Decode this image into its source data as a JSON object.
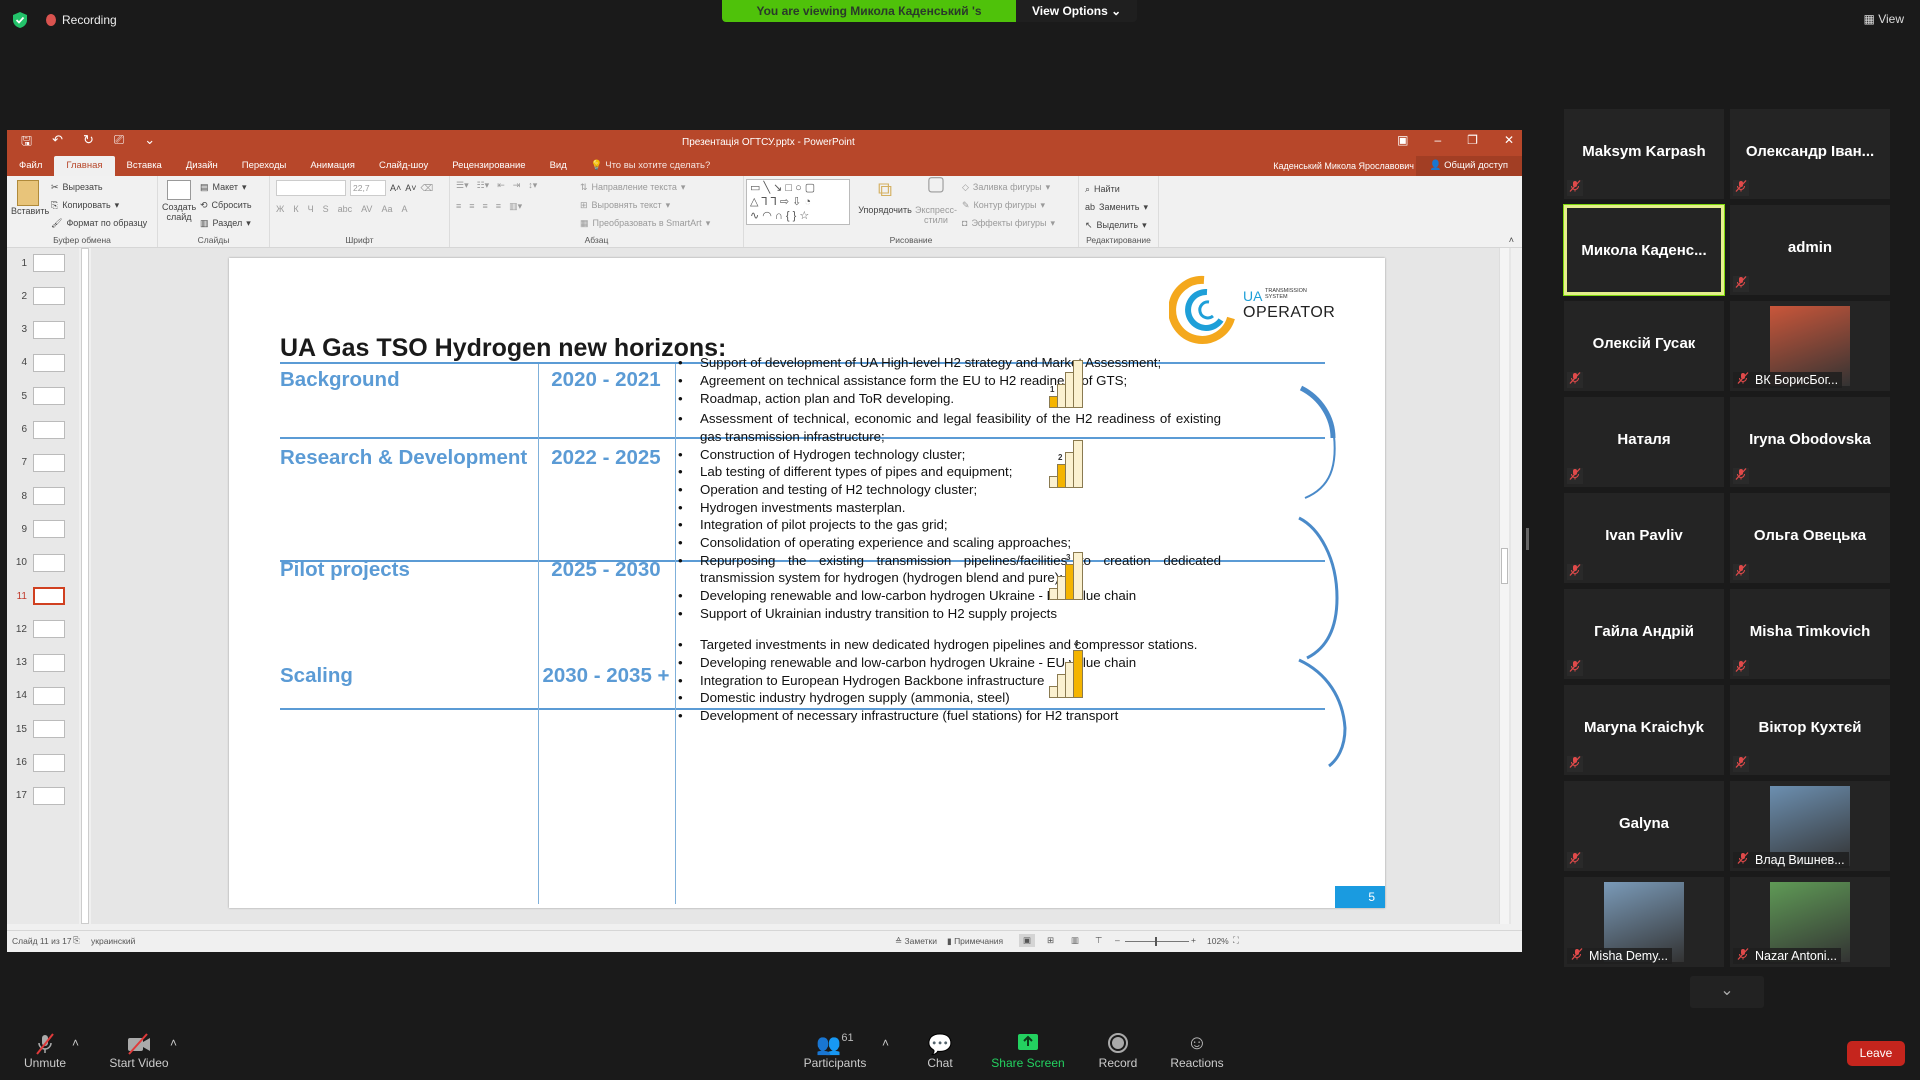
{
  "zoom": {
    "recording_label": "Recording",
    "viewing_banner": "You are viewing Микола Каденський 's screen",
    "view_options_label": "View Options",
    "top_view_label": "View",
    "toolbar": {
      "unmute": "Unmute",
      "start_video": "Start Video",
      "participants": "Participants",
      "participants_count": "61",
      "chat": "Chat",
      "share_screen": "Share Screen",
      "record": "Record",
      "reactions": "Reactions",
      "leave": "Leave"
    },
    "gallery": [
      {
        "name": "Maksym Karpash",
        "muted": true,
        "photo": false
      },
      {
        "name": "Олександр Іван...",
        "muted": true,
        "photo": false
      },
      {
        "name": "Микола  Каденс...",
        "muted": false,
        "photo": false,
        "active_speaker": true
      },
      {
        "name": "admin",
        "muted": true,
        "photo": false
      },
      {
        "name": "Олексій Гусак",
        "muted": true,
        "photo": false
      },
      {
        "name": "ВК БорисБог...",
        "muted": true,
        "photo": true
      },
      {
        "name": "Наталя",
        "muted": true,
        "photo": false
      },
      {
        "name": "Iryna Obodovska",
        "muted": true,
        "photo": false
      },
      {
        "name": "Ivan Pavliv",
        "muted": true,
        "photo": false
      },
      {
        "name": "Ольга Овецька",
        "muted": true,
        "photo": false
      },
      {
        "name": "Гайла Андрій",
        "muted": true,
        "photo": false
      },
      {
        "name": "Misha Timkovich",
        "muted": true,
        "photo": false
      },
      {
        "name": "Maryna Kraichyk",
        "muted": true,
        "photo": false
      },
      {
        "name": "Віктор Кухтєй",
        "muted": true,
        "photo": false
      },
      {
        "name": "Galyna",
        "muted": true,
        "photo": false
      },
      {
        "name": "Влад Вишнев...",
        "muted": true,
        "photo": true
      },
      {
        "name": "Misha Demy...",
        "muted": true,
        "photo": true
      },
      {
        "name": "Nazar Antoni...",
        "muted": true,
        "photo": true
      }
    ]
  },
  "ppt": {
    "window_title": "Презентація ОГТСУ.pptx - PowerPoint",
    "tabs": [
      "Файл",
      "Главная",
      "Вставка",
      "Дизайн",
      "Переходы",
      "Анимация",
      "Слайд-шоу",
      "Рецензирование",
      "Вид"
    ],
    "active_tab": "Главная",
    "tell_me": "Что вы хотите сделать?",
    "user_name": "Каденський Микола Ярославович",
    "share_label": "Общий доступ",
    "ribbon": {
      "clipboard": {
        "paste": "Вставить",
        "cut": "Вырезать",
        "copy": "Копировать",
        "format_painter": "Формат по образцу",
        "label": "Буфер обмена"
      },
      "slides": {
        "new_slide_1": "Создать",
        "new_slide_2": "слайд",
        "layout": "Макет",
        "reset": "Сбросить",
        "section": "Раздел",
        "label": "Слайды"
      },
      "font": {
        "font_size": "22,7",
        "label": "Шрифт",
        "bold": "Ж",
        "italic": "К",
        "underline": "Ч",
        "shadow": "S",
        "strike": "abc",
        "spacing": "AV",
        "case": "Aa",
        "color": "A"
      },
      "paragraph": {
        "text_direction": "Направление текста",
        "align_text": "Выровнять текст",
        "smartart": "Преобразовать в SmartArt",
        "label": "Абзац"
      },
      "drawing": {
        "arrange": "Упорядочить",
        "quick_styles_1": "Экспресс-",
        "quick_styles_2": "стили",
        "fill": "Заливка фигуры",
        "outline": "Контур фигуры",
        "effects": "Эффекты фигуры",
        "label": "Рисование"
      },
      "editing": {
        "find": "Найти",
        "replace": "Заменить",
        "select": "Выделить",
        "label": "Редактирование"
      }
    },
    "thumbnails": [
      "1",
      "2",
      "3",
      "4",
      "5",
      "6",
      "7",
      "8",
      "9",
      "10",
      "11",
      "12",
      "13",
      "14",
      "15",
      "16",
      "17"
    ],
    "current_slide": "11",
    "status": {
      "slide_of": "Слайд 11 из 17",
      "language": "украинский",
      "notes": "Заметки",
      "comments": "Примечания",
      "zoom": "102%"
    },
    "slide": {
      "title": "UA Gas TSO Hydrogen new horizons:",
      "logo": {
        "ua": "UA",
        "small1": "TRANSMISSION",
        "small2": "SYSTEM",
        "big": "OPERATOR"
      },
      "page_number": "5",
      "rows": [
        {
          "phase": "Background",
          "years": "2020 - 2021",
          "step": "1",
          "bullets": [
            "Support of development of UA High-level H2 strategy and  Market Assessment;",
            " Agreement on technical assistance form the EU to H2 readiness of GTS;",
            "Roadmap, action plan and ToR developing."
          ]
        },
        {
          "phase": "Research & Development",
          "years": "2022 - 2025",
          "step": "2",
          "bullets": [
            "Assessment of technical, economic and legal feasibility of the H2 readiness of existing gas transmission infrastructure;",
            "Construction of Hydrogen technology cluster;",
            "Lab testing of different types of pipes and equipment;",
            "Operation and testing of H2 technology cluster;",
            "Hydrogen investments masterplan."
          ]
        },
        {
          "phase": "Pilot projects",
          "years": "2025 - 2030",
          "step": "3",
          "bullets": [
            "Integration of pilot projects to the gas grid;",
            "Consolidation of operating experience and scaling approaches;",
            "Repurposing the existing transmission pipelines/facilities to creation dedicated transmission system for hydrogen (hydrogen blend and pure);",
            "Developing renewable and low-carbon hydrogen Ukraine - EU value chain",
            "Support of  Ukrainian industry transition to H2 supply projects"
          ]
        },
        {
          "phase": "Scaling",
          "years": "2030 - 2035 +",
          "step": "4",
          "bullets": [
            "Targeted investments in new dedicated hydrogen pipelines and compressor stations.",
            "Developing renewable and low-carbon hydrogen Ukraine - EU value chain",
            "Integration to European Hydrogen Backbone infrastructure",
            "Domestic industry hydrogen supply (ammonia, steel)",
            "Development of necessary infrastructure (fuel stations)  for H2 transport"
          ]
        }
      ]
    }
  },
  "colors": {
    "ppt_accent": "#b7472a",
    "slide_blue": "#5b9bd5",
    "zoom_green": "#4fc20a",
    "leave_red": "#c5251d",
    "stair_gold": "#f4b400"
  }
}
